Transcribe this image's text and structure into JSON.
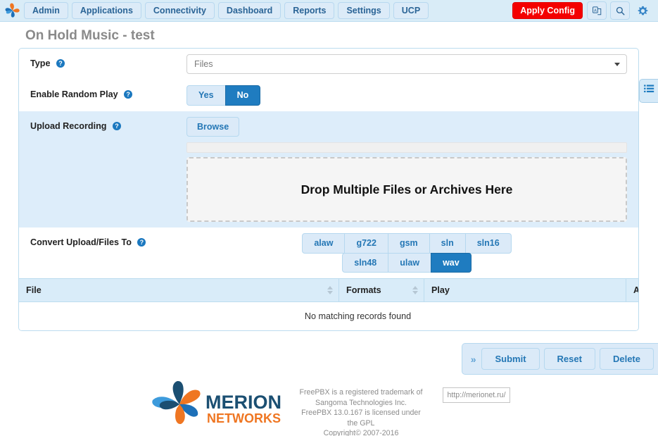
{
  "navbar": {
    "logo_name": "freepbx-swirl-logo",
    "items": [
      {
        "label": "Admin"
      },
      {
        "label": "Applications"
      },
      {
        "label": "Connectivity"
      },
      {
        "label": "Dashboard"
      },
      {
        "label": "Reports"
      },
      {
        "label": "Settings"
      },
      {
        "label": "UCP"
      }
    ],
    "apply_config": "Apply Config",
    "icons": [
      "translate-icon",
      "search-icon",
      "gear-icon"
    ],
    "accent_red": "#f40000",
    "accent_blue": "#1f7cc0"
  },
  "page": {
    "title": "On Hold Music - test"
  },
  "form": {
    "type": {
      "label": "Type",
      "value": "Files"
    },
    "random_play": {
      "label": "Enable Random Play",
      "options": [
        "Yes",
        "No"
      ],
      "selected": "No"
    },
    "upload": {
      "label": "Upload Recording",
      "browse_label": "Browse",
      "dropzone_text": "Drop Multiple Files or Archives Here"
    },
    "convert": {
      "label": "Convert Upload/Files To",
      "row1": [
        "alaw",
        "g722",
        "gsm",
        "sln",
        "sln16"
      ],
      "row2": [
        "sln48",
        "ulaw",
        "wav"
      ],
      "selected": "wav"
    }
  },
  "table": {
    "columns": [
      "File",
      "Formats",
      "Play",
      "Action"
    ],
    "empty_text": "No matching records found",
    "rows": []
  },
  "actions": {
    "expand": "»",
    "buttons": [
      "Submit",
      "Reset",
      "Delete"
    ]
  },
  "right_panel_tab": {
    "icon": "list-menu-icon"
  },
  "footer": {
    "logo_title": "MERION",
    "logo_subtitle": "NETWORKS",
    "line1": "FreePBX is a registered trademark of",
    "line2": "Sangoma Technologies Inc.",
    "line3": "FreePBX 13.0.167 is licensed under",
    "line4": "the GPL",
    "line5": "Copyright© 2007-2016",
    "url": "http://merionet.ru/"
  }
}
